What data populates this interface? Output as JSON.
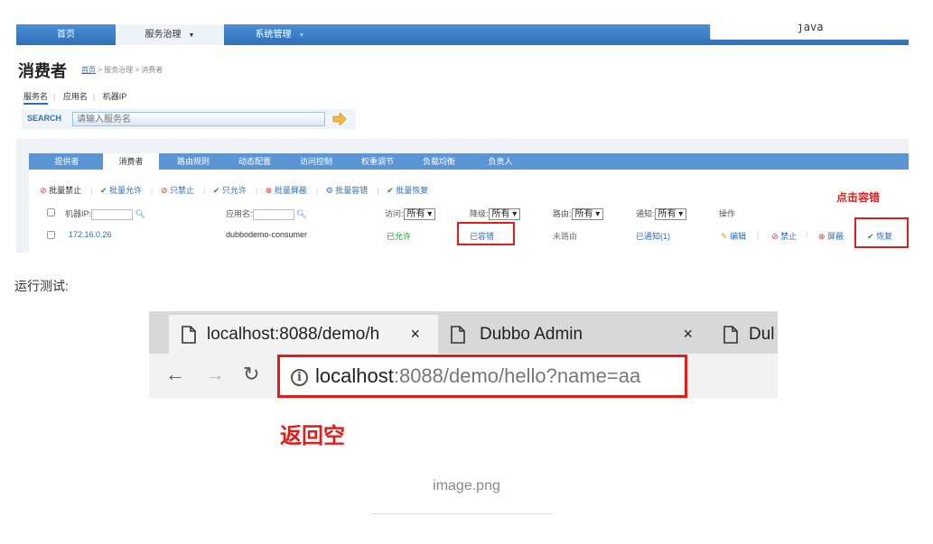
{
  "top_screenshot": {
    "nav_tabs": [
      "首页",
      "服务治理",
      "系统管理"
    ],
    "code_label": "java",
    "page_title": "消费者",
    "breadcrumb": {
      "home": "首页",
      "rest": " > 服务治理 > 消费者"
    },
    "sub_tabs": [
      "服务名",
      "应用名",
      "机器IP"
    ],
    "search": {
      "label": "SEARCH",
      "placeholder": "请输入服务名"
    },
    "module_tabs": [
      "提供者",
      "消费者",
      "路由规则",
      "动态配置",
      "访问控制",
      "权重调节",
      "负载均衡",
      "负责人"
    ],
    "actions": [
      "批量禁止",
      "批量允许",
      "只禁止",
      "只允许",
      "批量屏蔽",
      "批量容错",
      "批量恢复"
    ],
    "filters": {
      "ip_label": "机器IP:",
      "app_label": "应用名:",
      "access_label": "访问:",
      "access_value": "所有",
      "degrade_label": "降级:",
      "degrade_value": "所有",
      "route_label": "路由:",
      "route_value": "所有",
      "notify_label": "通知:",
      "notify_value": "所有",
      "ops_label": "操作"
    },
    "row": {
      "ip": "172.16.0.26",
      "app": "dubbodemo-consumer",
      "access": "已允许",
      "degrade": "已容错",
      "route": "未路由",
      "notify": "已通知(1)",
      "ops": [
        "编辑",
        "禁止",
        "屏蔽",
        "恢复"
      ]
    },
    "callout": "点击容错",
    "colors": {
      "nav": "#2f6fb8",
      "callout": "#e21b1b"
    }
  },
  "run_label": "运行测试:",
  "browser": {
    "tabs": [
      {
        "title": "localhost:8088/demo/h",
        "close": "×"
      },
      {
        "title": "Dubbo Admin",
        "close": "×"
      },
      {
        "title": "Dul"
      }
    ],
    "url_host": "localhost",
    "url_rest": ":8088/demo/hello?name=aa",
    "annotation": "返回空"
  },
  "caption": "image.png"
}
